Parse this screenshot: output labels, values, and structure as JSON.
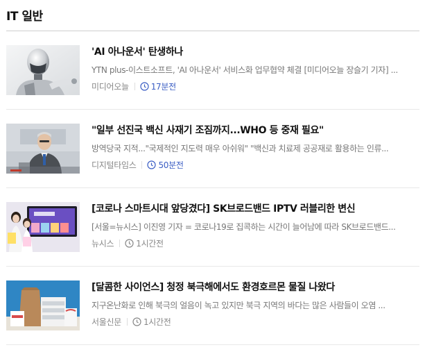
{
  "section": {
    "title": "IT 일반"
  },
  "accent_color": "#3b5ec4",
  "articles": [
    {
      "headline": "'AI 아나운서' 탄생하나",
      "summary": "YTN plus-이스트소프트, 'AI 아나운서' 서비스화 업무협약 체결 [미디어오늘 장슬기 기자] ...",
      "press": "미디어오늘",
      "time": "17분전",
      "time_recent": true,
      "thumb_icon": "robot-photo"
    },
    {
      "headline": "\"일부 선진국 백신 사재기 조짐까지...WHO 등 중재 필요\"",
      "summary": "방역당국 지적...\"국제적인 지도력 매우 아쉬워\" \"백신과 치료제 공공재로 활용하는 인류...",
      "press": "디지털타임스",
      "time": "50분전",
      "time_recent": true,
      "thumb_icon": "briefing-photo"
    },
    {
      "headline": "[코로나 스마트시대 앞당겼다] SK브로드밴드 IPTV 러블리한 변신",
      "summary": "[서울=뉴시스] 이진영 기자 = 코로나19로 집콕하는 시간이 늘어남에 따라 SK브로드밴드...",
      "press": "뉴시스",
      "time": "1시간전",
      "time_recent": false,
      "thumb_icon": "iptv-photo"
    },
    {
      "headline": "[달콤한 사이언스] 청정 북극해에서도 환경호르몬 물질 나왔다",
      "summary": "지구온난화로 인해 북극의 얼음이 녹고 있지만 북극 지역의 바다는 많은 사람들이 오염 ...",
      "press": "서울신문",
      "time": "1시간전",
      "time_recent": false,
      "thumb_icon": "packaging-photo"
    }
  ]
}
